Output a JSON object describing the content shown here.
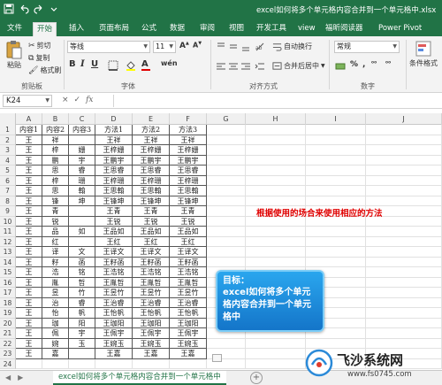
{
  "window": {
    "title": "excel如何将多个单元格内容合并到一个单元格中.xlsx"
  },
  "tabs": [
    {
      "label": "文件",
      "active": false
    },
    {
      "label": "开始",
      "active": true
    },
    {
      "label": "插入",
      "active": false
    },
    {
      "label": "页面布局",
      "active": false
    },
    {
      "label": "公式",
      "active": false
    },
    {
      "label": "数据",
      "active": false
    },
    {
      "label": "审阅",
      "active": false
    },
    {
      "label": "视图",
      "active": false
    },
    {
      "label": "开发工具",
      "active": false
    },
    {
      "label": "view",
      "active": false
    },
    {
      "label": "福昕阅读器",
      "active": false
    },
    {
      "label": "Power Pivot",
      "active": false
    }
  ],
  "ribbon": {
    "paste_label": "粘贴",
    "cut_label": "剪切",
    "copy_label": "复制",
    "format_painter_label": "格式刷",
    "clipboard_group": "剪贴板",
    "font_name": "等线",
    "font_size": "11",
    "bold_label": "B",
    "italic_label": "I",
    "underline_label": "U",
    "font_group": "字体",
    "wrap_text_label": "自动换行",
    "merge_center_label": "合并后居中",
    "alignment_group": "对齐方式",
    "number_format": "常规",
    "number_group": "数字",
    "conditional_format_label": "条件格式",
    "wen_glyph": "wén",
    "font_color_glyph": "A",
    "percent_label": "%",
    "comma_label": ",",
    "inc_decimal_label": "⁰⁰",
    "dec_decimal_label": "⁰⁰"
  },
  "formula_bar": {
    "name_box": "K24",
    "fx_label": "fx",
    "cancel_glyph": "×",
    "enter_glyph": "✓",
    "value": ""
  },
  "grid": {
    "columns": [
      "A",
      "B",
      "C",
      "D",
      "E",
      "F",
      "G",
      "H",
      "I",
      "J"
    ],
    "row_numbers": [
      "1",
      "2",
      "3",
      "4",
      "5",
      "6",
      "7",
      "8",
      "9",
      "10",
      "11",
      "12",
      "13",
      "14",
      "15",
      "16",
      "17",
      "18",
      "19",
      "20",
      "21",
      "22",
      "23",
      "24"
    ],
    "rows": [
      [
        "内容1",
        "内容2",
        "内容3",
        "方法1",
        "方法2",
        "方法3"
      ],
      [
        "王",
        "祥",
        "",
        "王祥",
        "王祥",
        "王祥"
      ],
      [
        "王",
        "梓",
        "姗",
        "王梓姗",
        "王梓姗",
        "王梓姗"
      ],
      [
        "王",
        "鹏",
        "宇",
        "王鹏宇",
        "王鹏宇",
        "王鹏宇"
      ],
      [
        "王",
        "思",
        "睿",
        "王思睿",
        "王思睿",
        "王思睿"
      ],
      [
        "王",
        "梓",
        "珊",
        "王梓珊",
        "王梓珊",
        "王梓珊"
      ],
      [
        "王",
        "思",
        "翰",
        "王思翰",
        "王思翰",
        "王思翰"
      ],
      [
        "王",
        "锋",
        "坤",
        "王锋坤",
        "王锋坤",
        "王锋坤"
      ],
      [
        "王",
        "青",
        "",
        "王青",
        "王青",
        "王青"
      ],
      [
        "王",
        "锐",
        "",
        "王锐",
        "王锐",
        "王锐"
      ],
      [
        "王",
        "品",
        "如",
        "王品如",
        "王品如",
        "王品如"
      ],
      [
        "王",
        "红",
        "",
        "王红",
        "王红",
        "王红"
      ],
      [
        "王",
        "译",
        "文",
        "王译文",
        "王译文",
        "王译文"
      ],
      [
        "王",
        "籽",
        "菡",
        "王籽菡",
        "王籽菡",
        "王籽菡"
      ],
      [
        "王",
        "浩",
        "铭",
        "王浩铭",
        "王浩铭",
        "王浩铭"
      ],
      [
        "王",
        "胤",
        "哲",
        "王胤哲",
        "王胤哲",
        "王胤哲"
      ],
      [
        "王",
        "昱",
        "竹",
        "王昱竹",
        "王昱竹",
        "王昱竹"
      ],
      [
        "王",
        "治",
        "睿",
        "王治睿",
        "王治睿",
        "王治睿"
      ],
      [
        "王",
        "怡",
        "帆",
        "王怡帆",
        "王怡帆",
        "王怡帆"
      ],
      [
        "王",
        "珈",
        "阳",
        "王珈阳",
        "王珈阳",
        "王珈阳"
      ],
      [
        "王",
        "佩",
        "宇",
        "王佩宇",
        "王佩宇",
        "王佩宇"
      ],
      [
        "王",
        "婉",
        "玉",
        "王婉玉",
        "王婉玉",
        "王婉玉"
      ],
      [
        "王",
        "嘉",
        "",
        "王嘉",
        "王嘉",
        "王嘉"
      ],
      [
        "",
        "",
        "",
        "",
        "",
        ""
      ]
    ]
  },
  "annotation": "根据使用的场合来使用相应的方法",
  "callout": {
    "title": "目标：",
    "body": "excel如何将多个单元格内容合并到一个单元格中"
  },
  "sheet": {
    "active_tab": "excel如何将多个单元格内容合并到一个单元格中",
    "add_glyph": "+"
  },
  "watermark": {
    "brand": "飞沙系统网",
    "url": "www.fs0745.com"
  },
  "colors": {
    "excel_green": "#217346",
    "annotation_red": "#e00000",
    "callout_blue": "#1475c9"
  }
}
